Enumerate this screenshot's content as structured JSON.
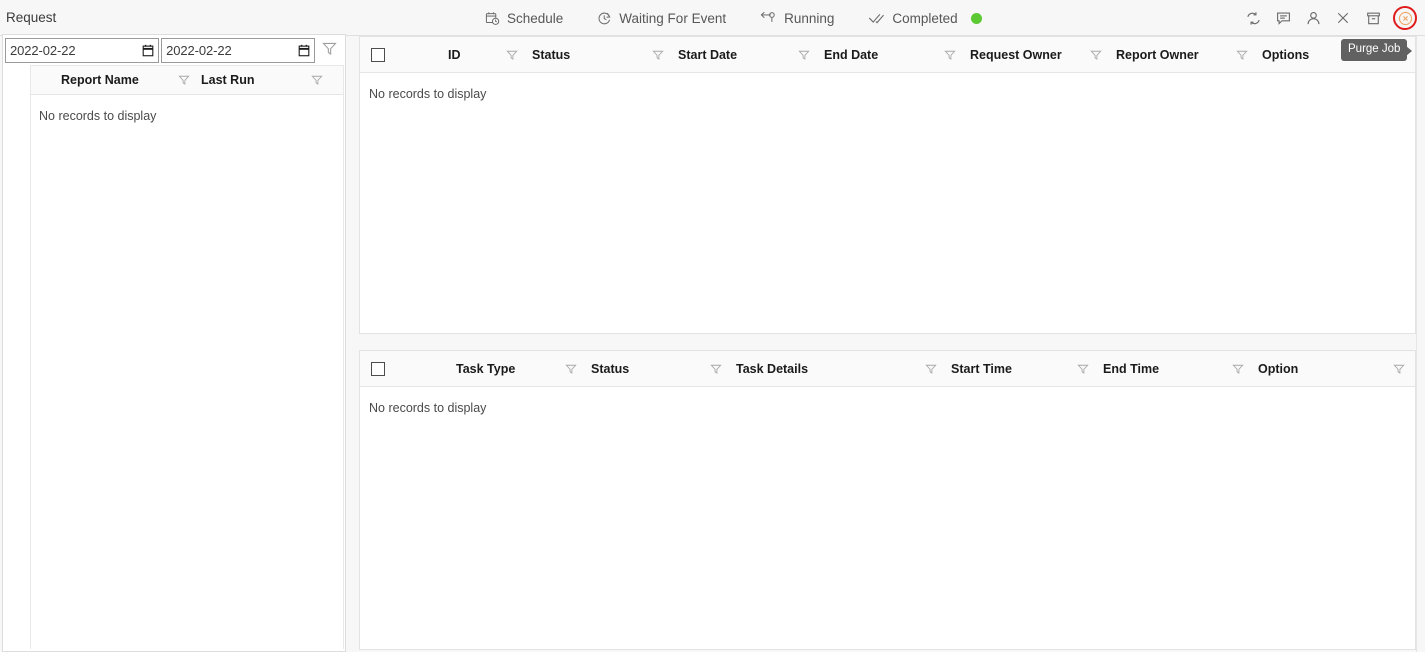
{
  "window": {
    "title": "Request"
  },
  "tabs": [
    {
      "label": "Schedule",
      "icon": "calendar-clock-icon",
      "status_dot": false
    },
    {
      "label": "Waiting For Event",
      "icon": "clock-icon",
      "status_dot": false
    },
    {
      "label": "Running",
      "icon": "running-arrow-icon",
      "status_dot": false
    },
    {
      "label": "Completed",
      "icon": "double-check-icon",
      "status_dot": true
    }
  ],
  "status_dot_color": "#5cc832",
  "highlight_color": "#e01b1b",
  "toolbar_icons": [
    {
      "name": "refresh-icon",
      "label": "Refresh"
    },
    {
      "name": "comment-icon",
      "label": "Comment"
    },
    {
      "name": "user-icon",
      "label": "User"
    },
    {
      "name": "close-icon",
      "label": "Close"
    },
    {
      "name": "archive-icon",
      "label": "Archive"
    },
    {
      "name": "purge-job-icon",
      "label": "Purge Job"
    }
  ],
  "tooltip": {
    "text": "Purge Job"
  },
  "left_panel": {
    "date_from": {
      "value": "2022-02-22",
      "placeholder": "yyyy-mm-dd"
    },
    "date_to": {
      "value": "2022-02-22",
      "placeholder": "yyyy-mm-dd"
    },
    "filter_button": "filter-icon",
    "grid": {
      "columns": [
        {
          "label": "Report Name",
          "filter": true
        },
        {
          "label": "Last Run",
          "filter": true
        }
      ],
      "empty_message": "No records to display",
      "rows": []
    }
  },
  "request_grid": {
    "columns": [
      {
        "label": "ID",
        "filter": true
      },
      {
        "label": "Status",
        "filter": true
      },
      {
        "label": "Start Date",
        "filter": true
      },
      {
        "label": "End Date",
        "filter": true
      },
      {
        "label": "Request Owner",
        "filter": true
      },
      {
        "label": "Report Owner",
        "filter": true
      },
      {
        "label": "Options",
        "filter": true
      }
    ],
    "empty_message": "No records to display",
    "rows": [],
    "select_all": false
  },
  "task_grid": {
    "columns": [
      {
        "label": "Task Type",
        "filter": true
      },
      {
        "label": "Status",
        "filter": true
      },
      {
        "label": "Task Details",
        "filter": true
      },
      {
        "label": "Start Time",
        "filter": true
      },
      {
        "label": "End Time",
        "filter": true
      },
      {
        "label": "Option",
        "filter": true
      }
    ],
    "empty_message": "No records to display",
    "rows": [],
    "select_all": false
  }
}
